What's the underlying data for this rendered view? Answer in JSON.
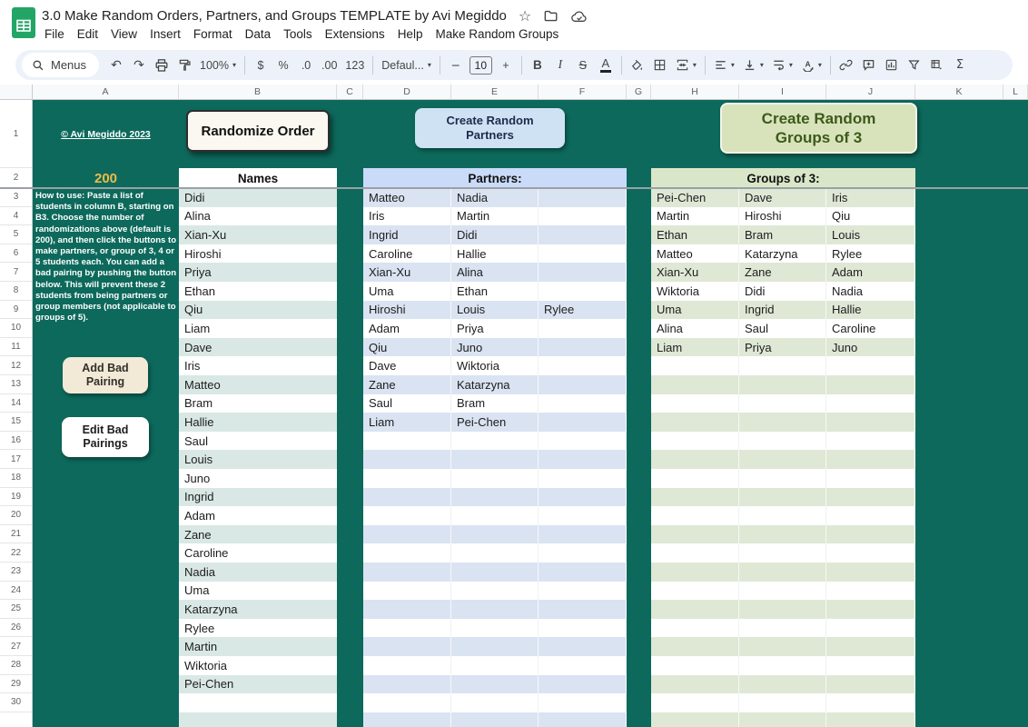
{
  "header": {
    "doc_title": "3.0 Make Random Orders, Partners, and Groups TEMPLATE by Avi Megiddo",
    "menus": [
      "File",
      "Edit",
      "View",
      "Insert",
      "Format",
      "Data",
      "Tools",
      "Extensions",
      "Help",
      "Make Random Groups"
    ]
  },
  "toolbar": {
    "menus_label": "Menus",
    "undo_icon": "↶",
    "redo_icon": "↷",
    "zoom_value": "100%",
    "currency_label": "$",
    "percent_label": "%",
    "decrease_decimal_label": ".0",
    "increase_decimal_label": ".00",
    "more_formats_label": "123",
    "font_family_value": "Defaul...",
    "decrease_font_label": "−",
    "font_size_value": "10",
    "increase_font_label": "+",
    "bold_label": "B",
    "italic_label": "I",
    "strikethrough_label": "S",
    "text_color_label": "A",
    "functions_label": "Σ"
  },
  "sheet": {
    "column_letters": [
      "A",
      "B",
      "C",
      "D",
      "E",
      "F",
      "G",
      "H",
      "I",
      "J",
      "K",
      "L"
    ],
    "row_count": 30,
    "a1_link": "© Avi Megiddo 2023",
    "randomizations_value": "200",
    "instructions": "How to use: Paste a list of students in column B, starting on B3.  Choose the number of randomizations above (default is 200), and then click the buttons to make partners, or group of 3, 4 or 5 students each.  You can add a bad pairing by pushing the button below.  This will prevent these 2 students from being partners or group members (not applicable to groups of 5).",
    "buttons": {
      "randomize_order": "Randomize Order",
      "add_bad": [
        "Add Bad",
        "Pairing"
      ],
      "edit_bad": [
        "Edit Bad",
        "Pairings"
      ],
      "create_partners": [
        "Create Random",
        "Partners"
      ],
      "create_groups": [
        "Create Random",
        "Groups of 3"
      ]
    },
    "names_header": "Names",
    "partners_header": "Partners:",
    "groups_header": "Groups of 3:",
    "names": [
      "Didi",
      "Alina",
      "Xian-Xu",
      "Hiroshi",
      "Priya",
      "Ethan",
      "Qiu",
      "Liam",
      "Dave",
      "Iris",
      "Matteo",
      "Bram",
      "Hallie",
      "Saul",
      "Louis",
      "Juno",
      "Ingrid",
      "Adam",
      "Zane",
      "Caroline",
      "Nadia",
      "Uma",
      "Katarzyna",
      "Rylee",
      "Martin",
      "Wiktoria",
      "Pei-Chen"
    ],
    "partners": [
      [
        "Matteo",
        "Nadia",
        ""
      ],
      [
        "Iris",
        "Martin",
        ""
      ],
      [
        "Ingrid",
        "Didi",
        ""
      ],
      [
        "Caroline",
        "Hallie",
        ""
      ],
      [
        "Xian-Xu",
        "Alina",
        ""
      ],
      [
        "Uma",
        "Ethan",
        ""
      ],
      [
        "Hiroshi",
        "Louis",
        "Rylee"
      ],
      [
        "Adam",
        "Priya",
        ""
      ],
      [
        "Qiu",
        "Juno",
        ""
      ],
      [
        "Dave",
        "Wiktoria",
        ""
      ],
      [
        "Zane",
        "Katarzyna",
        ""
      ],
      [
        "Saul",
        "Bram",
        ""
      ],
      [
        "Liam",
        "Pei-Chen",
        ""
      ]
    ],
    "groups": [
      [
        "Pei-Chen",
        "Dave",
        "Iris"
      ],
      [
        "Martin",
        "Hiroshi",
        "Qiu"
      ],
      [
        "Ethan",
        "Bram",
        "Louis"
      ],
      [
        "Matteo",
        "Katarzyna",
        "Rylee"
      ],
      [
        "Xian-Xu",
        "Zane",
        "Adam"
      ],
      [
        "Wiktoria",
        "Didi",
        "Nadia"
      ],
      [
        "Uma",
        "Ingrid",
        "Hallie"
      ],
      [
        "Alina",
        "Saul",
        "Caroline"
      ],
      [
        "Liam",
        "Priya",
        "Juno"
      ]
    ]
  },
  "colors": {
    "sheet_background": "#0d695c",
    "names_band_tint": "#d9e8e4",
    "partners_band_tint": "#dae3f1",
    "groups_band_tint": "#dfe8d5",
    "partners_header_bg": "#c9dbf8",
    "partners_button_bg": "#cfe2f3",
    "groups_header_bg": "#d9e7c8",
    "groups_button_bg": "#d8e3bb",
    "groups_button_text": "#3c5a1a",
    "randomizations_text": "#edbc49",
    "add_bad_button_bg": "#f2ead6"
  }
}
